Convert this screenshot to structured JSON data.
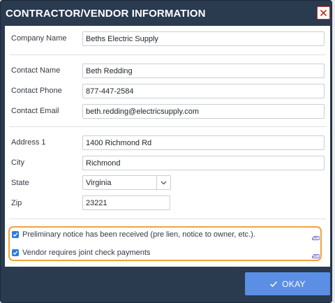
{
  "dialog": {
    "title": "CONTRACTOR/VENDOR INFORMATION",
    "close_icon": "close-x-icon"
  },
  "company": {
    "label": "Company Name",
    "value": "Beths Electric Supply"
  },
  "contact": {
    "name_label": "Contact Name",
    "name_value": "Beth Redding",
    "phone_label": "Contact Phone",
    "phone_value": "877-447-2584",
    "email_label": "Contact Email",
    "email_value": "beth.redding@electricsupply.com"
  },
  "address": {
    "address1_label": "Address 1",
    "address1_value": "1400 Richmond Rd",
    "city_label": "City",
    "city_value": "Richmond",
    "state_label": "State",
    "state_value": "Virginia",
    "zip_label": "Zip",
    "zip_value": "23221"
  },
  "options": [
    {
      "label": "Preliminary notice has been received (pre lien, notice to owner, etc.).",
      "checked": true,
      "icon": "paperclip-icon"
    },
    {
      "label": "Vendor requires joint check payments",
      "checked": true,
      "icon": "paperclip-icon"
    }
  ],
  "footer": {
    "okay_label": "OKAY",
    "okay_icon": "checkmark-icon"
  },
  "colors": {
    "header_bg": "#2a3a4f",
    "highlight_border": "#f0a33c",
    "primary_button": "#5b8fe6",
    "checkbox": "#2d7be0",
    "close_border": "#c0392b"
  }
}
